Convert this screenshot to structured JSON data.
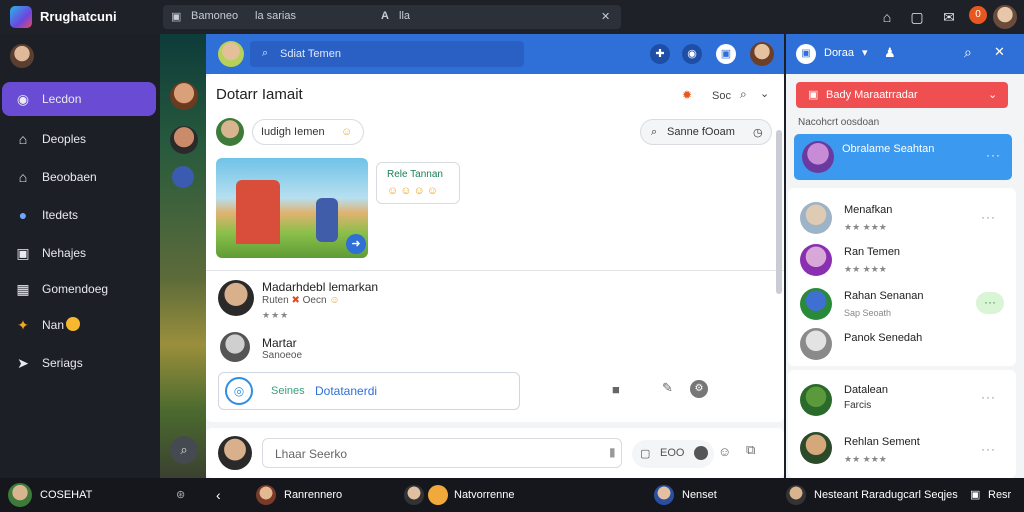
{
  "app": {
    "title": "Rrughatcuni"
  },
  "topbar": {
    "search_left": "Bamoneo",
    "search_mid": "la  sarias",
    "search_icon_text": "A",
    "search_right": "lla",
    "badge": "0"
  },
  "sidebar": {
    "items": [
      {
        "label": "Lecdon",
        "icon": "home-icon"
      },
      {
        "label": "Deoples",
        "icon": "people-icon"
      },
      {
        "label": "Beoobaen",
        "icon": "building-icon"
      },
      {
        "label": "Itedets",
        "icon": "globe-icon"
      },
      {
        "label": "Nehajes",
        "icon": "image-icon"
      },
      {
        "label": "Gomendoeg",
        "icon": "grid-icon"
      },
      {
        "label": "Nan",
        "icon": "star-icon"
      },
      {
        "label": "Seriags",
        "icon": "send-icon"
      }
    ],
    "user_name": "COSEHAT"
  },
  "main": {
    "header_search": "Sdiat  Temen",
    "title": "Dotarr Iamait",
    "title_action": "Soc",
    "post_pill": "Iudigh  Iemen",
    "search_pill": "Sanne  fOoam",
    "emote_card": "Rele Tannan",
    "comments": [
      {
        "name": "Madarhdebl  lemarkan",
        "text": "Ruten",
        "text2": "Oecn",
        "stars": "★★★"
      },
      {
        "name": "Martar",
        "text": "Sanoeoe",
        "stars": "★★★★"
      }
    ],
    "reply_label": "Seines",
    "reply_value": "Dotatanerdi",
    "compose_placeholder": "Lhaar  Seerko",
    "compose_btn": "EOO"
  },
  "right": {
    "action_label": "Bady  Maraatrradar",
    "section_label": "Nacohcrt  oosdoan",
    "highlight_name": "Obralame  Seahtan",
    "contacts": [
      {
        "name": "Menafkan",
        "status": "★★ ★★★"
      },
      {
        "name": "Ran  Temen",
        "status": "★★ ★★★"
      },
      {
        "name": "Rahan  Senanan",
        "status": "Sap  Seoath"
      },
      {
        "name": "Panok  Senedah",
        "status": ""
      },
      {
        "name": "Datalean",
        "status": "Farcis"
      },
      {
        "name": "Rehlan  Sement",
        "status": "★★ ★★★"
      }
    ],
    "dropdown_label": "Doraa"
  },
  "bottombar": {
    "items": [
      "Ranrennero",
      "Natvorrenne",
      "Nenset",
      "Nesteant  Raradugcarl  Seqjes",
      "Resr"
    ]
  },
  "colors": {
    "accent": "#2f6fd8",
    "active": "#6a4bd4",
    "alert": "#f04f52",
    "highlight": "#3b99f0"
  }
}
